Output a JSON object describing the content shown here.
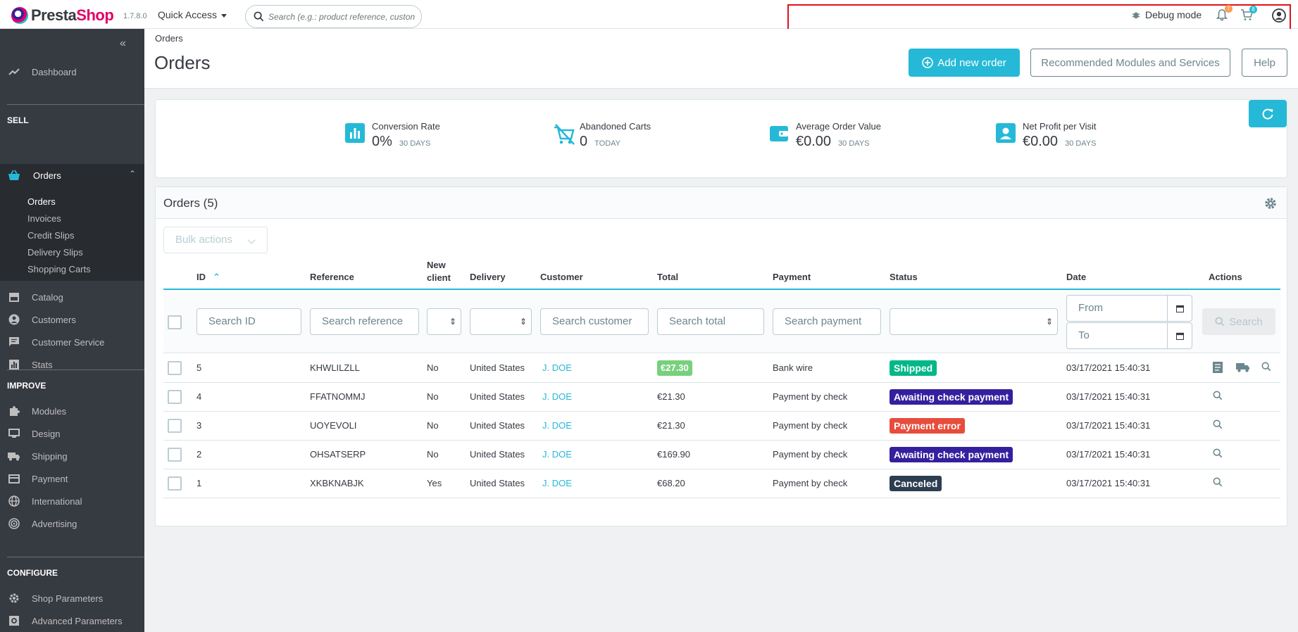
{
  "header": {
    "brand_part1": "Presta",
    "brand_part2": "Shop",
    "version": "1.7.8.0",
    "quick_access": "Quick Access",
    "search_placeholder": "Search (e.g.: product reference, custon",
    "debug_mode": "Debug mode",
    "notifications_count": "7",
    "orders_count": "8"
  },
  "sidebar": {
    "dashboard": "Dashboard",
    "sell_title": "SELL",
    "orders": "Orders",
    "orders_sub": [
      "Orders",
      "Invoices",
      "Credit Slips",
      "Delivery Slips",
      "Shopping Carts"
    ],
    "catalog": "Catalog",
    "customers": "Customers",
    "customer_service": "Customer Service",
    "stats": "Stats",
    "improve_title": "IMPROVE",
    "modules": "Modules",
    "design": "Design",
    "shipping": "Shipping",
    "payment": "Payment",
    "international": "International",
    "advertising": "Advertising",
    "configure_title": "CONFIGURE",
    "shop_parameters": "Shop Parameters",
    "advanced_parameters": "Advanced Parameters"
  },
  "page": {
    "breadcrumb": "Orders",
    "title": "Orders",
    "add_new_order": "Add new order",
    "recommended": "Recommended Modules and Services",
    "help": "Help"
  },
  "kpis": [
    {
      "label": "Conversion Rate",
      "value": "0%",
      "period": "30 DAYS"
    },
    {
      "label": "Abandoned Carts",
      "value": "0",
      "period": "TODAY"
    },
    {
      "label": "Average Order Value",
      "value": "€0.00",
      "period": "30 DAYS"
    },
    {
      "label": "Net Profit per Visit",
      "value": "€0.00",
      "period": "30 DAYS"
    }
  ],
  "orders_card": {
    "title": "Orders (5)",
    "bulk_actions": "Bulk actions",
    "columns": {
      "id": "ID",
      "reference": "Reference",
      "new_client_1": "New",
      "new_client_2": "client",
      "delivery": "Delivery",
      "customer": "Customer",
      "total": "Total",
      "payment": "Payment",
      "status": "Status",
      "date": "Date",
      "actions": "Actions"
    },
    "filters": {
      "id": "Search ID",
      "reference": "Search reference",
      "customer": "Search customer",
      "total": "Search total",
      "payment": "Search payment",
      "date_from": "From",
      "date_to": "To",
      "search_button": "Search"
    },
    "rows": [
      {
        "id": "5",
        "reference": "KHWLILZLL",
        "new_client": "No",
        "delivery": "United States",
        "customer": "J. DOE",
        "total": "€27.30",
        "payment": "Bank wire",
        "status": "Shipped",
        "status_color": "#01b887",
        "date": "03/17/2021 15:40:31"
      },
      {
        "id": "4",
        "reference": "FFATNOMMJ",
        "new_client": "No",
        "delivery": "United States",
        "customer": "J. DOE",
        "total": "€21.30",
        "payment": "Payment by check",
        "status": "Awaiting check payment",
        "status_color": "#34209e",
        "date": "03/17/2021 15:40:31"
      },
      {
        "id": "3",
        "reference": "UOYEVOLI",
        "new_client": "No",
        "delivery": "United States",
        "customer": "J. DOE",
        "total": "€21.30",
        "payment": "Payment by check",
        "status": "Payment error",
        "status_color": "#e74c3c",
        "date": "03/17/2021 15:40:31"
      },
      {
        "id": "2",
        "reference": "OHSATSERP",
        "new_client": "No",
        "delivery": "United States",
        "customer": "J. DOE",
        "total": "€169.90",
        "payment": "Payment by check",
        "status": "Awaiting check payment",
        "status_color": "#34209e",
        "date": "03/17/2021 15:40:31"
      },
      {
        "id": "1",
        "reference": "XKBKNABJK",
        "new_client": "Yes",
        "delivery": "United States",
        "customer": "J. DOE",
        "total": "€68.20",
        "payment": "Payment by check",
        "status": "Canceled",
        "status_color": "#2c3e50",
        "date": "03/17/2021 15:40:31"
      }
    ]
  },
  "colors": {
    "accent": "#25b9d7",
    "sidebar": "#363a41",
    "brand_pink": "#df0067"
  }
}
